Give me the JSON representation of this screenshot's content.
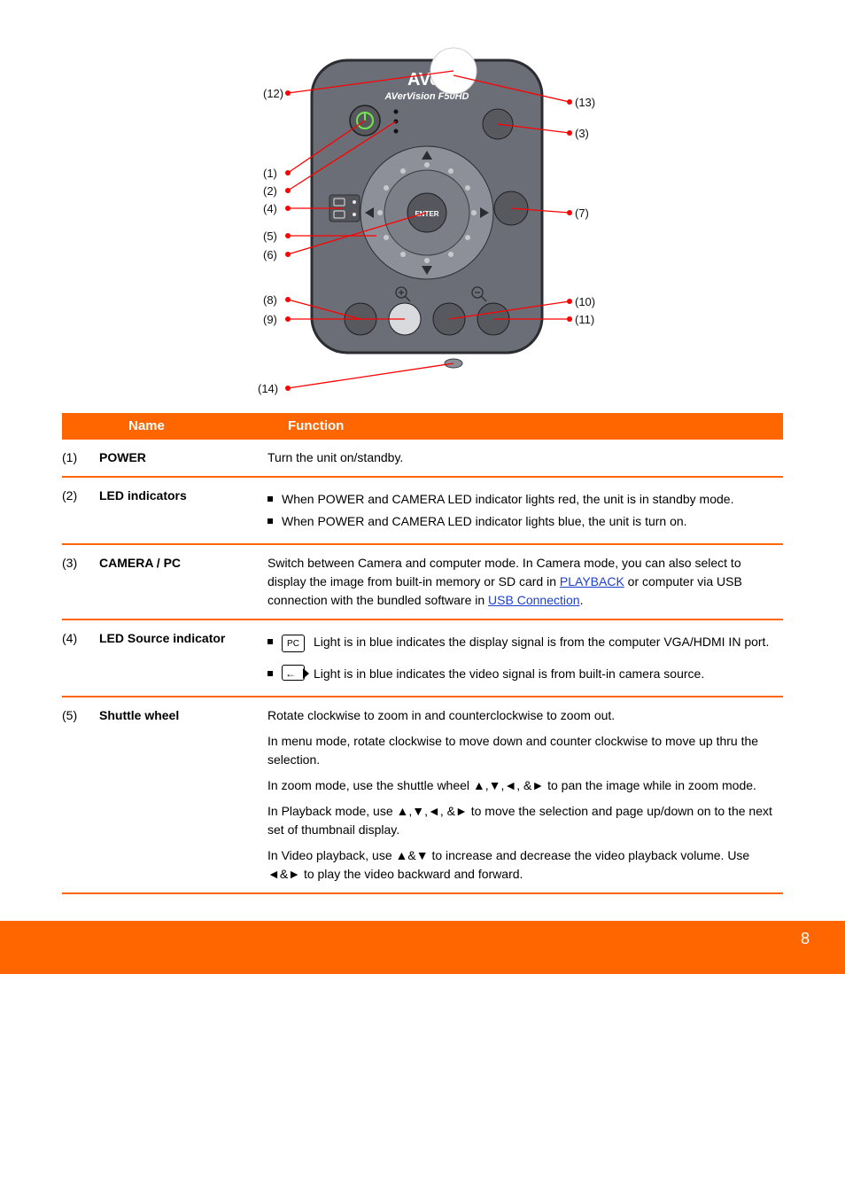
{
  "diagram": {
    "brand_line1": "AVer",
    "brand_line2": "AVerVision F50HD",
    "enter_label": "ENTER",
    "label_1": "(1)",
    "label_2": "(2)",
    "label_3": "(3)",
    "label_4": "(4)",
    "label_5": "(5)",
    "label_8": "(8)",
    "label_9": "(9)",
    "label_6": "(6)",
    "label_7": "(7)",
    "label_10": "(10)",
    "label_11": "(11)",
    "label_12": "(12)",
    "label_13": "(13)",
    "label_14": "(14)"
  },
  "header": {
    "name": "Name",
    "function": "Function"
  },
  "rows": {
    "r1": {
      "idx": "(1)",
      "name": "POWER",
      "desc": "Turn the unit on/standby."
    },
    "r2": {
      "idx": "(2)",
      "name": "LED indicators",
      "b1": "When POWER and CAMERA LED indicator lights red, the unit is in standby mode.",
      "b2": "When POWER and CAMERA LED indicator lights blue, the unit is turn on."
    },
    "r3": {
      "idx": "(3)",
      "name": "CAMERA / PC",
      "desc_pre": "Switch between Camera and computer mode. In Camera mode, you can also select to display the image from built-in memory or SD card in ",
      "link": "PLAYBACK",
      "desc_post": " or computer via USB connection with the bundled software in ",
      "link2": "USB Connection",
      "desc_end": "."
    },
    "r4": {
      "idx": "(4)",
      "name": "LED Source indicator",
      "b1_pre": "",
      "b1_icon": "PC",
      "b1_post": "Light is in blue indicates the display signal is from the computer VGA/HDMI IN port.",
      "b2_icon": "cam",
      "b2_post": "Light is in blue indicates the video signal is from built-in camera source."
    },
    "r5": {
      "idx": "(5)",
      "name": "Shuttle wheel",
      "p1": "Rotate clockwise to zoom in and counterclockwise to zoom out.",
      "p2": "In menu mode, rotate clockwise to move down and counter clockwise to move up thru the selection.",
      "p3": "In zoom mode, use the shuttle wheel ▲,▼,◄, &► to pan the image while in zoom mode.",
      "p4": "In Playback mode, use ▲,▼,◄, &► to move the selection and page up/down on to the next set of thumbnail display.",
      "p5": "In Video playback, use ▲&▼ to increase and decrease the video playback volume. Use ◄&► to play the video backward and forward."
    }
  },
  "page_num": "8"
}
